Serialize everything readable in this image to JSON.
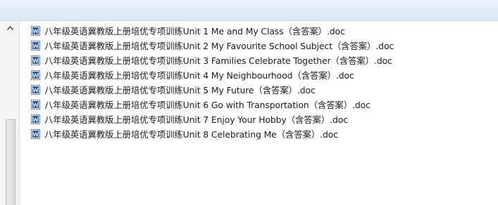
{
  "files": [
    {
      "name": "八年级英语冀教版上册培优专项训练Unit 1 Me and My Class（含答案）.doc",
      "icon": "word-doc-icon"
    },
    {
      "name": "八年级英语冀教版上册培优专项训练Unit 2 My Favourite School Subject（含答案）.doc",
      "icon": "word-doc-icon"
    },
    {
      "name": "八年级英语冀教版上册培优专项训练Unit 3 Families Celebrate Together（含答案）.doc",
      "icon": "word-doc-icon"
    },
    {
      "name": "八年级英语冀教版上册培优专项训练Unit 4 My Neighbourhood（含答案）.doc",
      "icon": "word-doc-icon"
    },
    {
      "name": "八年级英语冀教版上册培优专项训练Unit 5 My Future（含答案）.doc",
      "icon": "word-doc-icon"
    },
    {
      "name": "八年级英语冀教版上册培优专项训练Unit 6 Go with Transportation（含答案）.doc",
      "icon": "word-doc-icon"
    },
    {
      "name": "八年级英语冀教版上册培优专项训练Unit 7 Enjoy Your Hobby（含答案）.doc",
      "icon": "word-doc-icon"
    },
    {
      "name": "八年级英语冀教版上册培优专项训练Unit 8 Celebrating Me（含答案）.doc",
      "icon": "word-doc-icon"
    }
  ],
  "colors": {
    "icon_blue": "#2b5797",
    "text": "#1a1a1a"
  }
}
